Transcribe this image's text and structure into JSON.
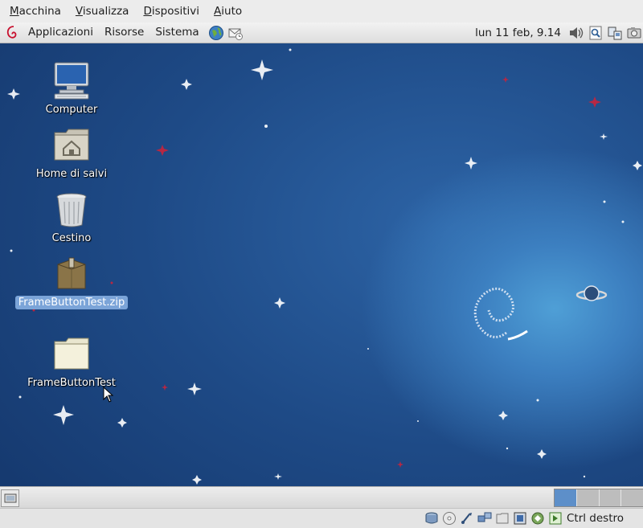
{
  "vm_menubar": {
    "items": [
      {
        "mnemonic": "M",
        "rest": "acchina"
      },
      {
        "mnemonic": "V",
        "rest": "isualizza"
      },
      {
        "mnemonic": "D",
        "rest": "ispositivi"
      },
      {
        "mnemonic": "A",
        "rest": "iuto"
      }
    ]
  },
  "top_panel": {
    "menus": [
      "Applicazioni",
      "Risorse",
      "Sistema"
    ],
    "clock": "lun 11 feb,  9.14",
    "launchers": [
      "web-browser-icon",
      "mail-client-icon"
    ],
    "tray": [
      "volume-icon",
      "search-tool-icon",
      "network-icon",
      "screenshot-icon"
    ]
  },
  "desktop": {
    "icons": [
      {
        "label": "Computer",
        "icon": "computer-icon",
        "selected": false
      },
      {
        "label": "Home di salvi",
        "icon": "home-folder-icon",
        "selected": false
      },
      {
        "label": "Cestino",
        "icon": "trash-icon",
        "selected": false
      },
      {
        "label": "FrameButtonTest.zip",
        "icon": "archive-icon",
        "selected": true
      },
      {
        "label": "FrameButtonTest",
        "icon": "folder-icon",
        "selected": false
      }
    ]
  },
  "bottom_panel": {
    "workspaces": 4,
    "active_workspace": 1
  },
  "vm_statusbar": {
    "icons": [
      "hard-disk-icon",
      "optical-drive-icon",
      "usb-icon",
      "network-adapter-icon",
      "shared-folder-icon",
      "display-icon",
      "virtualization-icon",
      "mouse-integration-icon"
    ],
    "host_key": "Ctrl destro"
  },
  "colors": {
    "selection": "#7ba4d8",
    "desktop_blue": "#1e4a86",
    "workspace_active": "#5d8fc9"
  }
}
